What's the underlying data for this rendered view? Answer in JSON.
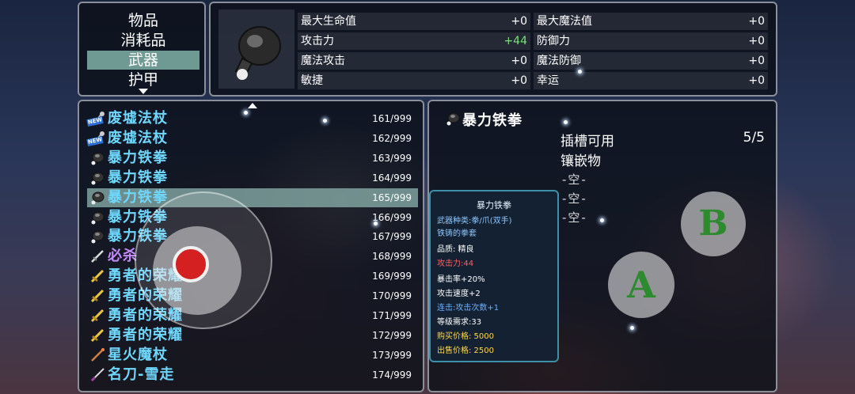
{
  "categories": [
    "物品",
    "消耗品",
    "武器",
    "护甲"
  ],
  "active_category": "武器",
  "stats": [
    {
      "label": "最大生命值",
      "value": "+0"
    },
    {
      "label": "最大魔法值",
      "value": "+0"
    },
    {
      "label": "攻击力",
      "value": "+44"
    },
    {
      "label": "防御力",
      "value": "+0"
    },
    {
      "label": "魔法攻击",
      "value": "+0"
    },
    {
      "label": "魔法防御",
      "value": "+0"
    },
    {
      "label": "敏捷",
      "value": "+0"
    },
    {
      "label": "幸运",
      "value": "+0"
    }
  ],
  "items": [
    {
      "name": "废墟法杖",
      "count": "161/999",
      "icon": "staff-icon",
      "new": "NEW"
    },
    {
      "name": "废墟法杖",
      "count": "162/999",
      "icon": "staff-icon",
      "new": "NEW"
    },
    {
      "name": "暴力铁拳",
      "count": "163/999",
      "icon": "fist-icon"
    },
    {
      "name": "暴力铁拳",
      "count": "164/999",
      "icon": "fist-icon"
    },
    {
      "name": "暴力铁拳",
      "count": "165/999",
      "icon": "fist-icon"
    },
    {
      "name": "暴力铁拳",
      "count": "166/999",
      "icon": "fist-icon"
    },
    {
      "name": "暴力铁拳",
      "count": "167/999",
      "icon": "fist-icon"
    },
    {
      "name": "必杀",
      "count": "168/999",
      "icon": "dagger-icon"
    },
    {
      "name": "勇者的荣耀",
      "count": "169/999",
      "icon": "sword-icon"
    },
    {
      "name": "勇者的荣耀",
      "count": "170/999",
      "icon": "sword-icon"
    },
    {
      "name": "勇者的荣耀",
      "count": "171/999",
      "icon": "sword-icon"
    },
    {
      "name": "勇者的荣耀",
      "count": "172/999",
      "icon": "sword-icon"
    },
    {
      "name": "星火魔杖",
      "count": "173/999",
      "icon": "wand-icon"
    },
    {
      "name": "名刀-雪走",
      "count": "174/999",
      "icon": "katana-icon"
    }
  ],
  "selected_index": 4,
  "detail": {
    "title": "暴力铁拳",
    "slots_label": "插槽可用",
    "slots_value": "5/5",
    "gems_label": "镶嵌物",
    "empty_slots": [
      "-空-",
      "-空-",
      "-空-"
    ]
  },
  "tooltip": {
    "title": "暴力铁拳",
    "lines": [
      "武器种类:拳/爪(双手)",
      "铁铸的拳套",
      "品质: 精良",
      "攻击力:44",
      "暴击率+20%",
      "攻击速度+2",
      "连击:攻击次数+1",
      "等级需求:33",
      "购买价格: 5000",
      "出售价格: 2500"
    ]
  },
  "buttons": {
    "a": "A",
    "b": "B"
  }
}
